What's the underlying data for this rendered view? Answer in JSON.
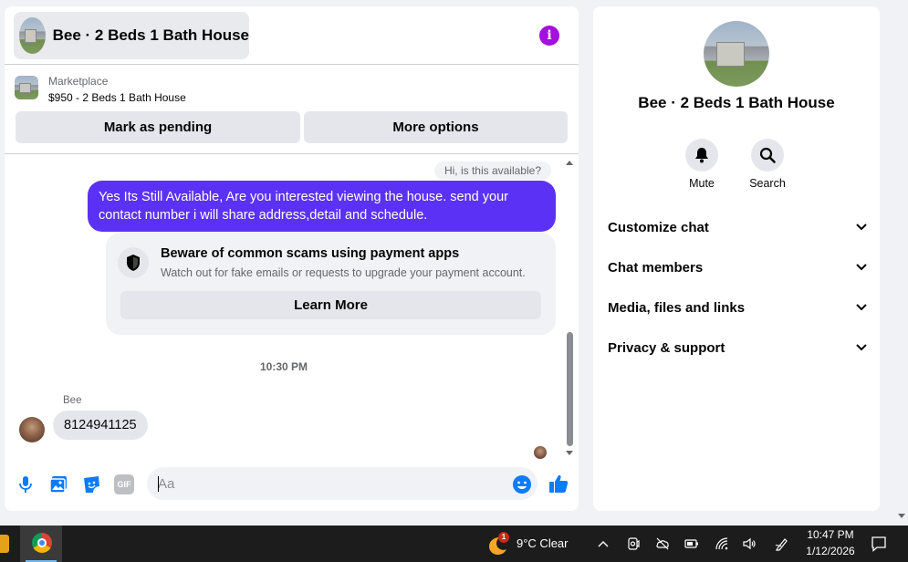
{
  "header": {
    "title": "Bee · 2 Beds 1 Bath House",
    "info_icon": "info-icon",
    "info_glyph": "i"
  },
  "marketplace": {
    "source": "Marketplace",
    "listing": "$950 - 2 Beds 1 Bath House",
    "mark_pending_label": "Mark as pending",
    "more_options_label": "More options"
  },
  "messages": {
    "outgoing_1": "Hi, is this available?",
    "outgoing_2": "Yes Its Still Available, Are you interested viewing the house. send your contact number i will share address,detail and schedule.",
    "scam_notice": {
      "title": "Beware of common scams using payment apps",
      "body": "Watch out for fake emails or requests to upgrade your payment account.",
      "button": "Learn More"
    },
    "timestamp": "10:30 PM",
    "sender_name": "Bee",
    "incoming_1": "8124941125"
  },
  "composer": {
    "placeholder": "Aa",
    "gif_label": "GIF"
  },
  "details": {
    "title": "Bee · 2 Beds 1 Bath House",
    "actions": [
      {
        "label": "Mute",
        "icon": "bell-icon"
      },
      {
        "label": "Search",
        "icon": "search-icon"
      }
    ],
    "sections": [
      {
        "label": "Customize chat"
      },
      {
        "label": "Chat members"
      },
      {
        "label": "Media, files and links"
      },
      {
        "label": "Privacy & support"
      }
    ]
  },
  "taskbar": {
    "weather": "9°C  Clear",
    "weather_badge": "1",
    "time": "10:47 PM",
    "date": "1/12/2026"
  },
  "colors": {
    "accent": "#0a7cff",
    "outgoing_bubble": "#5b32f5",
    "info": "#a50fe0"
  }
}
